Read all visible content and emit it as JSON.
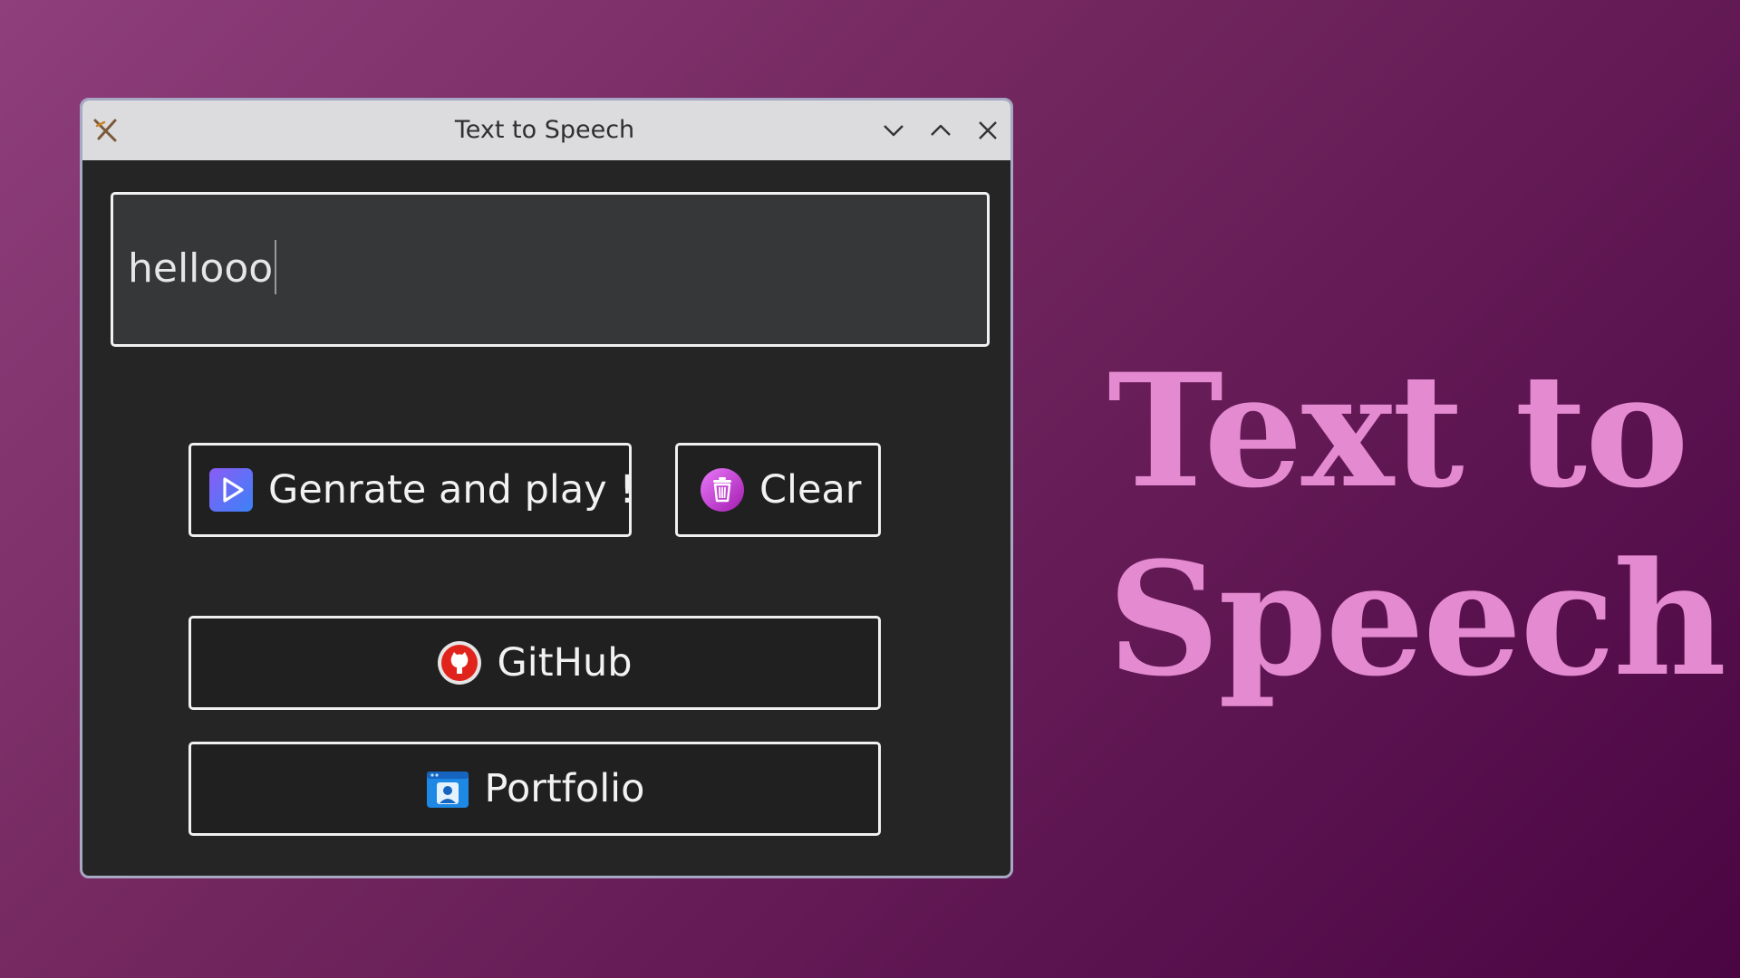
{
  "window": {
    "title": "Text to Speech",
    "icon": "x-app-icon",
    "controls": [
      "chevron-down-icon",
      "chevron-up-icon",
      "close-icon"
    ]
  },
  "text_field": {
    "value": "hellooo"
  },
  "buttons": {
    "generate": {
      "label": "Genrate and play !",
      "icon": "play-icon"
    },
    "clear": {
      "label": "Clear",
      "icon": "trash-icon"
    },
    "github": {
      "label": "GitHub",
      "icon": "github-icon"
    },
    "portfolio": {
      "label": "Portfolio",
      "icon": "portfolio-icon"
    }
  },
  "hero": {
    "line1": "Text to",
    "line2": "Speech"
  },
  "colors": {
    "hero_text": "#e48ad0",
    "window_bg": "#252525",
    "field_bg": "#363739",
    "titlebar_bg": "#dcdcdf",
    "background_start": "#8e3f7c",
    "background_end": "#4a0542"
  }
}
